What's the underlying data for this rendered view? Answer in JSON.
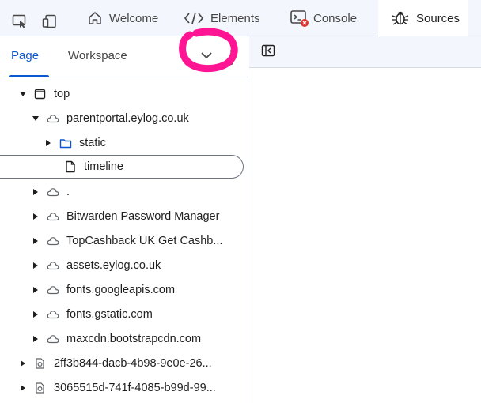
{
  "tabs": [
    {
      "label": "Welcome",
      "icon": "home-icon"
    },
    {
      "label": "Elements",
      "icon": "code-brackets-icon"
    },
    {
      "label": "Console",
      "icon": "console-icon"
    },
    {
      "label": "Sources",
      "icon": "bug-icon",
      "active": true
    }
  ],
  "sources_panel": {
    "subtabs": [
      "Page",
      "Workspace"
    ],
    "active_subtab": "Page"
  },
  "tree": [
    {
      "label": "top",
      "depth": 0,
      "expanded": true,
      "type": "frame"
    },
    {
      "label": "parentportal.eylog.co.uk",
      "depth": 1,
      "expanded": true,
      "type": "cloud"
    },
    {
      "label": "static",
      "depth": 2,
      "expanded": false,
      "type": "folder"
    },
    {
      "label": "timeline",
      "depth": 2,
      "type": "file",
      "selected": true
    },
    {
      "label": ".",
      "depth": 1,
      "expanded": false,
      "type": "cloud"
    },
    {
      "label": "Bitwarden Password Manager",
      "depth": 1,
      "expanded": false,
      "type": "cloud"
    },
    {
      "label": "TopCashback UK Get Cashb...",
      "depth": 1,
      "expanded": false,
      "type": "cloud"
    },
    {
      "label": "assets.eylog.co.uk",
      "depth": 1,
      "expanded": false,
      "type": "cloud"
    },
    {
      "label": "fonts.googleapis.com",
      "depth": 1,
      "expanded": false,
      "type": "cloud"
    },
    {
      "label": "fonts.gstatic.com",
      "depth": 1,
      "expanded": false,
      "type": "cloud"
    },
    {
      "label": "maxcdn.bootstrapcdn.com",
      "depth": 1,
      "expanded": false,
      "type": "cloud"
    },
    {
      "label": "2ff3b844-dacb-4b98-9e0e-26...",
      "depth": 0,
      "expanded": false,
      "type": "worker"
    },
    {
      "label": "3065515d-741f-4085-b99d-99...",
      "depth": 0,
      "expanded": false,
      "type": "worker"
    }
  ],
  "colors": {
    "accent": "#0b57d0",
    "error_badge": "#dc362e",
    "annotation": "#ff1493",
    "toolbar_bg": "#f3f6fc"
  }
}
